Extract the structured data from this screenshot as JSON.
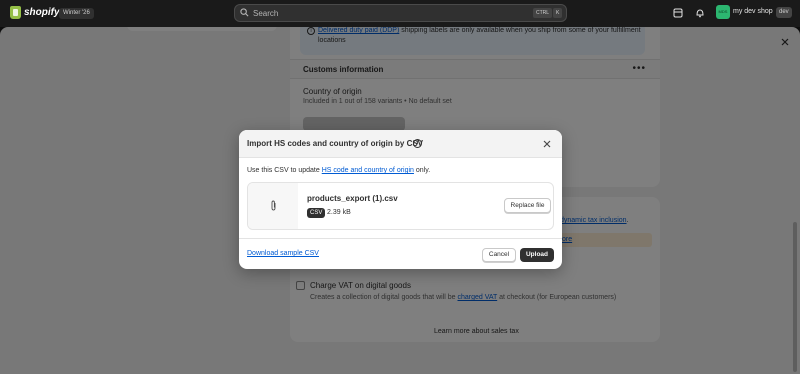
{
  "topbar": {
    "brand": "shopify",
    "edition": "Winter '26",
    "search_placeholder": "Search",
    "shortcut_keys": [
      "CTRL",
      "K"
    ],
    "shop_name": "my dev shop",
    "shop_badge": "dev"
  },
  "background": {
    "ddp_banner": {
      "link": "Delivered duty paid (DDP)",
      "text": " shipping labels are only available when you ship from some of your fulfillment locations"
    },
    "customs_title": "Customs information",
    "country_label": "Country of origin",
    "country_sub": "Included in 1 out of 158 variants • No default set",
    "tax_link": "dynamic tax inclusion",
    "tax_suffix": ".",
    "warn_text": "ore",
    "vat_label": "Charge VAT on digital goods",
    "vat_desc_prefix": "Creates a collection of digital goods that will be ",
    "vat_desc_link": "charged VAT",
    "vat_desc_suffix": " at checkout (for European customers)",
    "learn_more": "Learn more about sales tax"
  },
  "modal": {
    "title": "Import HS codes and country of origin by CSV",
    "desc_prefix": "Use this CSV to update ",
    "desc_link": "HS code and country of origin",
    "desc_suffix": " only.",
    "file_name": "products_export (1).csv",
    "file_type": "CSV",
    "file_size": "2.39 kB",
    "replace_label": "Replace file",
    "sample_link": "Download sample CSV",
    "cancel_label": "Cancel",
    "upload_label": "Upload"
  }
}
